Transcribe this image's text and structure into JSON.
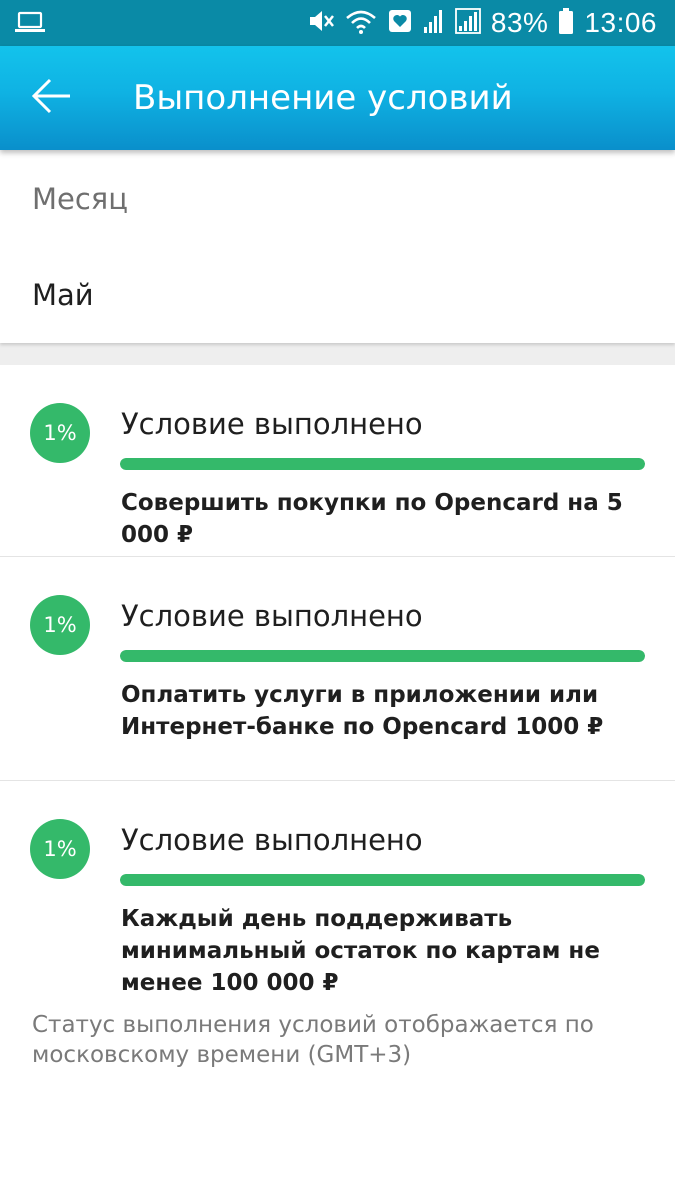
{
  "status_bar": {
    "battery": "83%",
    "time": "13:06",
    "icons": [
      "laptop-icon",
      "mute-icon",
      "wifi-icon",
      "heart-box-icon",
      "signal-icon",
      "signal-icon",
      "battery-icon"
    ]
  },
  "app_bar": {
    "title": "Выполнение условий",
    "back_icon": "arrow-left-icon"
  },
  "month": {
    "label": "Месяц",
    "value": "Май"
  },
  "conditions": [
    {
      "percent": "1%",
      "status": "Условие выполнено",
      "progress": 1.0,
      "description": "Совершить покупки по Opencard на 5 000 ₽"
    },
    {
      "percent": "1%",
      "status": "Условие выполнено",
      "progress": 1.0,
      "description": "Оплатить услуги в приложении или Интернет-банке по Opencard 1000 ₽"
    },
    {
      "percent": "1%",
      "status": "Условие выполнено",
      "progress": 1.0,
      "description": "Каждый день поддерживать минимальный остаток по картам не менее 100 000 ₽"
    }
  ],
  "footnote": "Статус выполнения условий отображается по московскому времени (GMT+3)",
  "colors": {
    "accent": "#34b96a",
    "app_bar": "#13c3ec",
    "status_bar": "#0a8aa6"
  }
}
